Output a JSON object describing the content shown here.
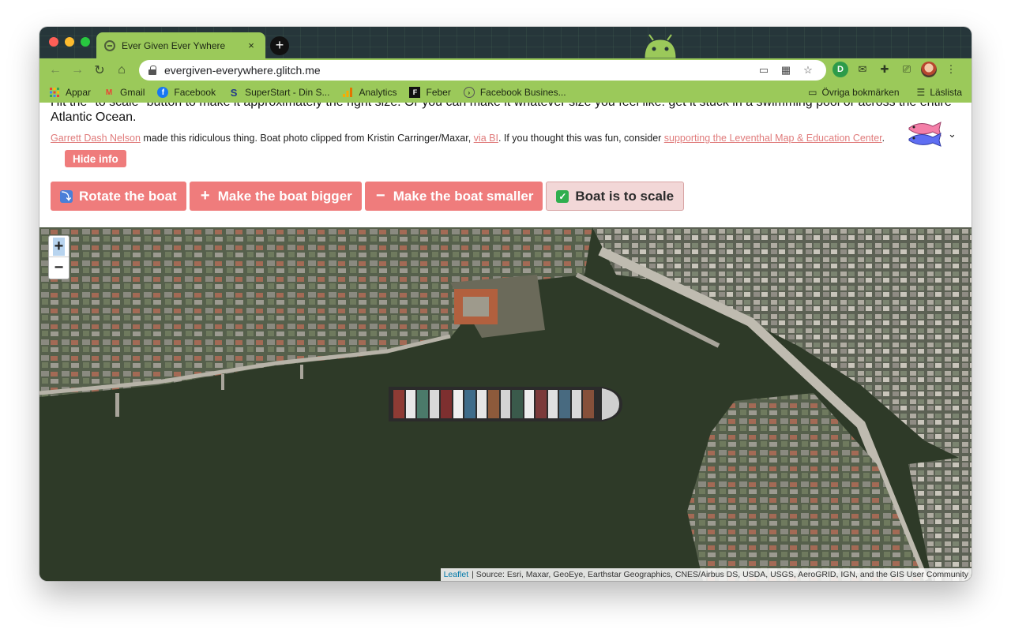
{
  "browser": {
    "tab_title": "Ever Given Ever Ywhere",
    "tab_close": "×",
    "new_tab": "+",
    "url": "evergiven-everywhere.glitch.me",
    "nav": {
      "back": "←",
      "forward": "→",
      "reload": "↻",
      "home": "⌂"
    },
    "menu": "⋮"
  },
  "bookmarks": {
    "items": [
      {
        "label": "Appar",
        "icon": "apps-grid-icon"
      },
      {
        "label": "Gmail",
        "icon": "gmail-icon"
      },
      {
        "label": "Facebook",
        "icon": "facebook-icon"
      },
      {
        "label": "SuperStart - Din S...",
        "icon": "superstart-icon"
      },
      {
        "label": "Analytics",
        "icon": "analytics-icon"
      },
      {
        "label": "Feber",
        "icon": "feber-icon"
      },
      {
        "label": "Facebook Busines...",
        "icon": "facebook-business-icon"
      }
    ],
    "other_bookmarks": "Övriga bokmärken",
    "reading_list": "Läslista"
  },
  "page": {
    "intro_line1": "Hit the \"to scale\" button to make it approximately the right size. Or you can make it whatever size you feel like: get it stuck in a swimming pool or across the entire",
    "intro_line2": "Atlantic Ocean.",
    "credit_author": "Garrett Dash Nelson",
    "credit_text1": " made this ridiculous thing. Boat photo clipped from Kristin Carringer/Maxar, ",
    "credit_link_bi": "via BI",
    "credit_text2": ". If you thought this was fun, consider ",
    "credit_link_support": "supporting the Leventhal Map & Education Center",
    "credit_text3": ".",
    "hide_info": "Hide info",
    "buttons": {
      "rotate": "Rotate the boat",
      "bigger": "Make the boat bigger",
      "smaller": "Make the boat smaller",
      "scale": "Boat is to scale"
    }
  },
  "map": {
    "zoom_in": "+",
    "zoom_out": "−",
    "attribution_leaflet": "Leaflet",
    "attribution_source": "| Source: Esri, Maxar, GeoEye, Earthstar Geographics, CNES/Airbus DS, USDA, USGS, AeroGRID, IGN, and the GIS User Community"
  },
  "colors": {
    "browser_theme": "#9bc95a",
    "button_accent": "#ef7c7c",
    "link": "#e07b7b",
    "water": "#2f3a2a"
  }
}
